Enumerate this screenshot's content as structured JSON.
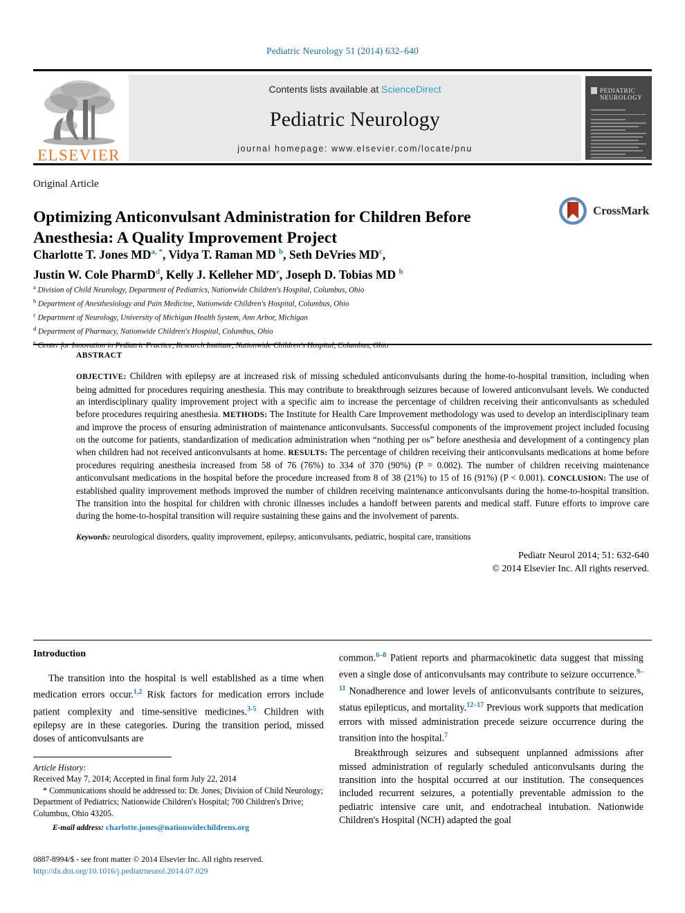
{
  "running_head": "Pediatric Neurology 51 (2014) 632–640",
  "masthead": {
    "publisher_name": "ELSEVIER",
    "contents_prefix": "Contents lists available at ",
    "contents_link": "ScienceDirect",
    "journal_title": "Pediatric Neurology",
    "homepage": "journal homepage: www.elsevier.com/locate/pnu",
    "cover_title_line1": "PEDIATRIC",
    "cover_title_line2": "NEUROLOGY"
  },
  "article": {
    "type": "Original Article",
    "title": "Optimizing Anticonvulsant Administration for Children Before Anesthesia: A Quality Improvement Project",
    "crossmark_label": "CrossMark",
    "authors_line1": "Charlotte T. Jones MD",
    "authors": [
      {
        "name": "Charlotte T. Jones MD",
        "sup": "a, *"
      },
      {
        "name": "Vidya T. Raman MD",
        "sup": "b"
      },
      {
        "name": "Seth DeVries MD",
        "sup": "c"
      },
      {
        "name": "Justin W. Cole PharmD",
        "sup": "d"
      },
      {
        "name": "Kelly J. Kelleher MD",
        "sup": "e"
      },
      {
        "name": "Joseph D. Tobias MD",
        "sup": "b"
      }
    ],
    "affiliations": [
      {
        "marker": "a",
        "text": "Division of Child Neurology, Department of Pediatrics, Nationwide Children's Hospital, Columbus, Ohio"
      },
      {
        "marker": "b",
        "text": "Department of Anesthesiology and Pain Medicine, Nationwide Children's Hospital, Columbus, Ohio"
      },
      {
        "marker": "c",
        "text": "Department of Neurology, University of Michigan Health System, Ann Arbor, Michigan"
      },
      {
        "marker": "d",
        "text": "Department of Pharmacy, Nationwide Children's Hospital, Columbus, Ohio"
      },
      {
        "marker": "e",
        "text": "Center for Innovation in Pediatric Practice, Research Institute, Nationwide Children's Hospital, Columbus, Ohio"
      }
    ]
  },
  "abstract": {
    "heading": "ABSTRACT",
    "objective_label": "OBJECTIVE:",
    "objective_text": " Children with epilepsy are at increased risk of missing scheduled anticonvulsants during the home-to-hospital transition, including when being admitted for procedures requiring anesthesia. This may contribute to breakthrough seizures because of lowered anticonvulsant levels. We conducted an interdisciplinary quality improvement project with a specific aim to increase the percentage of children receiving their anticonvulsants as scheduled before procedures requiring anesthesia. ",
    "methods_label": "METHODS:",
    "methods_text": " The Institute for Health Care Improvement methodology was used to develop an interdisciplinary team and improve the process of ensuring administration of maintenance anticonvulsants. Successful components of the improvement project included focusing on the outcome for patients, standardization of medication administration when “nothing per os” before anesthesia and development of a contingency plan when children had not received anticonvulsants at home. ",
    "results_label": "RESULTS:",
    "results_text": " The percentage of children receiving their anticonvulsants medications at home before procedures requiring anesthesia increased from 58 of 76 (76%) to 334 of 370 (90%) (P = 0.002). The number of children receiving maintenance anticonvulsant medications in the hospital before the procedure increased from 8 of 38 (21%) to 15 of 16 (91%) (P < 0.001). ",
    "conclusion_label": "CONCLUSION:",
    "conclusion_text": " The use of established quality improvement methods improved the number of children receiving maintenance anticonvulsants during the home-to-hospital transition. The transition into the hospital for children with chronic illnesses includes a handoff between parents and medical staff. Future efforts to improve care during the home-to-hospital transition will require sustaining these gains and the involvement of parents.",
    "keywords_label": "Keywords:",
    "keywords_text": " neurological disorders, quality improvement, epilepsy, anticonvulsants, pediatric, hospital care, transitions",
    "citation": "Pediatr Neurol 2014; 51: 632-640",
    "copyright": "© 2014 Elsevier Inc. All rights reserved."
  },
  "body": {
    "intro_heading": "Introduction",
    "left_para1_a": "The transition into the hospital is well established as a time when medication errors occur.",
    "left_para1_ref1": "1,2",
    "left_para1_b": " Risk factors for medication errors include patient complexity and time-sensitive medicines.",
    "left_para1_ref2": "3-5",
    "left_para1_c": " Children with epilepsy are in these categories. During the transition period, missed doses of anticonvulsants are",
    "right_para1_a": "common.",
    "right_para1_ref1": "6–8",
    "right_para1_b": " Patient reports and pharmacokinetic data suggest that missing even a single dose of anticonvulsants may contribute to seizure occurrence.",
    "right_para1_ref2": "9–11",
    "right_para1_c": " Nonadherence and lower levels of anticonvulsants contribute to seizures, status epilepticus, and mortality.",
    "right_para1_ref3": "12–17",
    "right_para1_d": " Previous work supports that medication errors with missed administration precede seizure occurrence during the transition into the hospital.",
    "right_para1_ref4": "7",
    "right_para2": "Breakthrough seizures and subsequent unplanned admissions after missed administration of regularly scheduled anticonvulsants during the transition into the hospital occurred at our institution. The consequences included recurrent seizures, a potentially preventable admission to the pediatric intensive care unit, and endotracheal intubation. Nationwide Children's Hospital (NCH) adapted the goal"
  },
  "footnotes": {
    "history_label": "Article History:",
    "history_text": "Received May 7, 2014; Accepted in final form July 22, 2014",
    "corresponding": "* Communications should be addressed to: Dr. Jones; Division of Child Neurology; Department of Pediatrics; Nationwide Children's Hospital; 700 Children's Drive; Columbus, Ohio 43205.",
    "email_label": "E-mail address:",
    "email": "charlotte.jones@nationwidechildrens.org",
    "issn_line": "0887-8994/$ - see front matter © 2014 Elsevier Inc. All rights reserved.",
    "doi": "http://dx.doi.org/10.1016/j.pediatrneurol.2014.07.029"
  },
  "colors": {
    "link_blue": "#1b7bb5",
    "sciencedirect_blue": "#2f9fd0",
    "elsevier_orange": "#e87722",
    "crossmark_red": "#b5311b",
    "crossmark_blue": "#5b8bbf"
  }
}
